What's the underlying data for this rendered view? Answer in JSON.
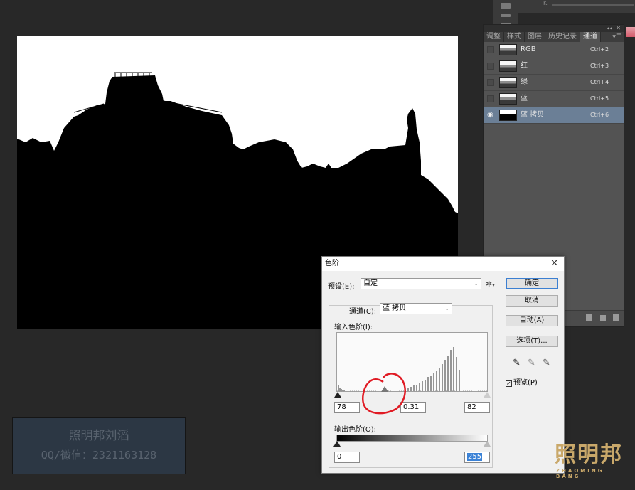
{
  "right_panel_letter": "K",
  "channels_panel": {
    "tabs": [
      {
        "label": "调整",
        "active": false
      },
      {
        "label": "样式",
        "active": false
      },
      {
        "label": "图层",
        "active": false
      },
      {
        "label": "历史记录",
        "active": false
      },
      {
        "label": "通道",
        "active": true
      }
    ],
    "collapse_glyph": "◂◂",
    "close_glyph": "✕",
    "menu_glyph": "▾☰",
    "channels": [
      {
        "name": "RGB",
        "shortcut": "Ctrl+2",
        "visible": false,
        "selected": false,
        "thumb": "photo"
      },
      {
        "name": "红",
        "shortcut": "Ctrl+3",
        "visible": false,
        "selected": false,
        "thumb": "photo"
      },
      {
        "name": "绿",
        "shortcut": "Ctrl+4",
        "visible": false,
        "selected": false,
        "thumb": "photo"
      },
      {
        "name": "蓝",
        "shortcut": "Ctrl+5",
        "visible": false,
        "selected": false,
        "thumb": "photo"
      },
      {
        "name": "蓝 拷贝",
        "shortcut": "Ctrl+6",
        "visible": true,
        "selected": true,
        "thumb": "mask"
      }
    ]
  },
  "levels_dialog": {
    "title": "色阶",
    "close_glyph": "✕",
    "preset_label": "预设(E):",
    "preset_value": "自定",
    "channel_label": "通道(C):",
    "channel_value": "蓝 拷贝",
    "input_levels_label": "输入色阶(I):",
    "input_black": "78",
    "input_gamma": "0.31",
    "input_white": "82",
    "output_levels_label": "输出色阶(O):",
    "output_black": "0",
    "output_white": "255",
    "buttons": {
      "ok": "确定",
      "cancel": "取消",
      "auto": "自动(A)",
      "options": "选项(T)..."
    },
    "preview_label": "预览(P)",
    "preview_checked": true,
    "gear_glyph": "✲",
    "dropdown_glyph": "⌄"
  },
  "watermark": {
    "line1": "照明邦刘滔",
    "line2": "QQ/微信：2321163128"
  },
  "logo": {
    "name_cn": "照明邦",
    "name_en": "ZHAOMING BANG"
  },
  "colors": {
    "workspace_bg": "#282828",
    "panel_bg": "#535353",
    "selected_channel": "#6b7f96",
    "annotation_red": "#e01b24",
    "logo_gold": "#c9a86a"
  }
}
